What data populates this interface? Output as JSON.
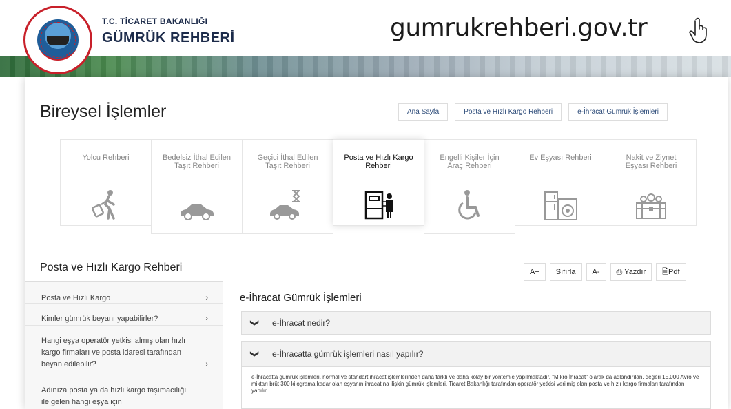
{
  "header": {
    "ministry": "T.C. TİCARET BAKANLIĞI",
    "brand": "GÜMRÜK REHBERİ",
    "url": "gumrukrehberi.gov.tr",
    "logo_ring_text": "T.C. TİCARET BAKANLIĞI · GÜMRÜK REHBERİ",
    "cursor_icon": "hand-pointer-icon"
  },
  "page": {
    "title": "Bireysel İşlemler",
    "top_links": [
      "Ana Sayfa",
      "Posta ve Hızlı Kargo Rehberi",
      "e-İhracat Gümrük İşlemleri"
    ]
  },
  "tiles": [
    {
      "label": "Yolcu Rehberi",
      "icon": "traveler-icon"
    },
    {
      "label": "Bedelsiz İthal Edilen Taşıt Rehberi",
      "icon": "car-icon"
    },
    {
      "label": "Geçici İthal Edilen Taşıt Rehberi",
      "icon": "car-hourglass-icon"
    },
    {
      "label": "Posta ve Hızlı Kargo Rehberi",
      "icon": "mailbox-courier-icon",
      "active": true
    },
    {
      "label": "Engelli Kişiler İçin Araç Rehberi",
      "icon": "wheelchair-icon"
    },
    {
      "label": "Ev Eşyası Rehberi",
      "icon": "household-appliances-icon"
    },
    {
      "label": "Nakit ve Ziynet Eşyası Rehberi",
      "icon": "treasure-chest-icon"
    }
  ],
  "section": {
    "title": "Posta ve Hızlı Kargo Rehberi",
    "tools": [
      "A+",
      "Sıfırla",
      "A-",
      "Yazdır",
      "Pdf"
    ]
  },
  "sidebar": {
    "items": [
      "Posta ve Hızlı Kargo",
      "Kimler gümrük beyanı yapabilirler?",
      "Hangi eşya operatör yetkisi almış olan hızlı kargo firmaları ve posta idaresi tarafından beyan edilebilir?",
      "Adınıza posta ya da hızlı kargo taşımacılığı ile gelen hangi eşya için"
    ]
  },
  "content": {
    "title": "e-İhracat Gümrük İşlemleri",
    "accordion": [
      "e-İhracat nedir?",
      "e-İhracatta gümrük işlemleri nasıl yapılır?"
    ],
    "panel_text": "e-İhracatta gümrük işlemleri, normal ve standart ihracat işlemlerinden daha farklı ve daha kolay bir yöntemle yapılmaktadır. \"Mikro İhracat\" olarak da adlandırılan, değeri 15.000 Avro ve miktarı brüt 300 kilograma kadar olan eşyanın ihracatına ilişkin gümrük işlemleri, Ticaret Bakanlığı tarafından operatör yetkisi verilmiş olan posta ve hızlı kargo firmaları tarafından yapılır."
  },
  "colors": {
    "brand_navy": "#1c2b4a",
    "link_blue": "#2b4a78",
    "logo_red": "#c8202a",
    "band_green": "#2e6a3a"
  }
}
